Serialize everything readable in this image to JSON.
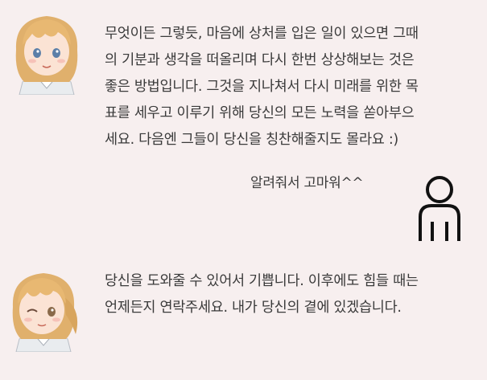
{
  "colors": {
    "background": "#f7efef",
    "text": "#3a3a3a",
    "user_icon_stroke": "#111111"
  },
  "messages": [
    {
      "role": "assistant",
      "avatar_icon": "girl-avatar-icon",
      "text": "무엇이든 그렇듯, 마음에 상처를 입은 일이 있으면 그때\n의 기분과 생각을 떠올리며 다시 한번 상상해보는 것은\n좋은 방법입니다. 그것을 지나쳐서 다시 미래를 위한 목\n표를 세우고 이루기 위해 당신의 모든 노력을 쏟아부으\n세요. 다음엔 그들이 당신을 칭찬해줄지도 몰라요 :)"
    },
    {
      "role": "user",
      "avatar_icon": "user-icon",
      "text": "알려줘서 고마워^^"
    },
    {
      "role": "assistant",
      "avatar_icon": "girl-winking-avatar-icon",
      "text": "당신을 도와줄 수 있어서 기쁩니다. 이후에도 힘들 때는\n언제든지 연락주세요. 내가 당신의 곁에 있겠습니다."
    }
  ]
}
